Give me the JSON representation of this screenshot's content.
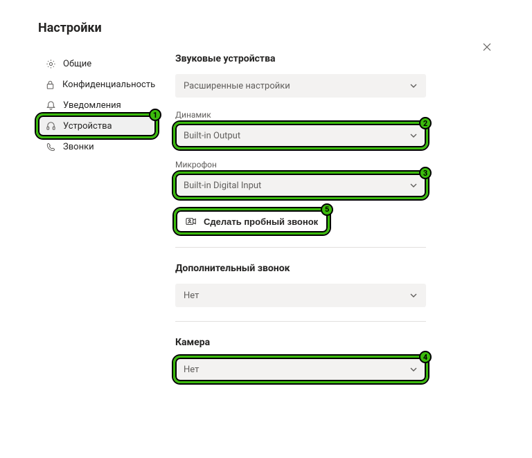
{
  "dialog": {
    "title": "Настройки"
  },
  "sidebar": {
    "items": [
      {
        "label": "Общие"
      },
      {
        "label": "Конфиденциальность"
      },
      {
        "label": "Уведомления"
      },
      {
        "label": "Устройства"
      },
      {
        "label": "Звонки"
      }
    ]
  },
  "main": {
    "audio_devices_heading": "Звуковые устройства",
    "advanced": {
      "value": "Расширенные настройки"
    },
    "speaker": {
      "label": "Динамик",
      "value": "Built-in Output"
    },
    "microphone": {
      "label": "Микрофон",
      "value": "Built-in Digital Input"
    },
    "test_call_label": "Сделать пробный звонок",
    "secondary_ringer": {
      "heading": "Дополнительный звонок",
      "value": "Нет"
    },
    "camera": {
      "heading": "Камера",
      "value": "Нет"
    }
  },
  "annotations": {
    "1": "1",
    "2": "2",
    "3": "3",
    "4": "4",
    "5": "5"
  }
}
